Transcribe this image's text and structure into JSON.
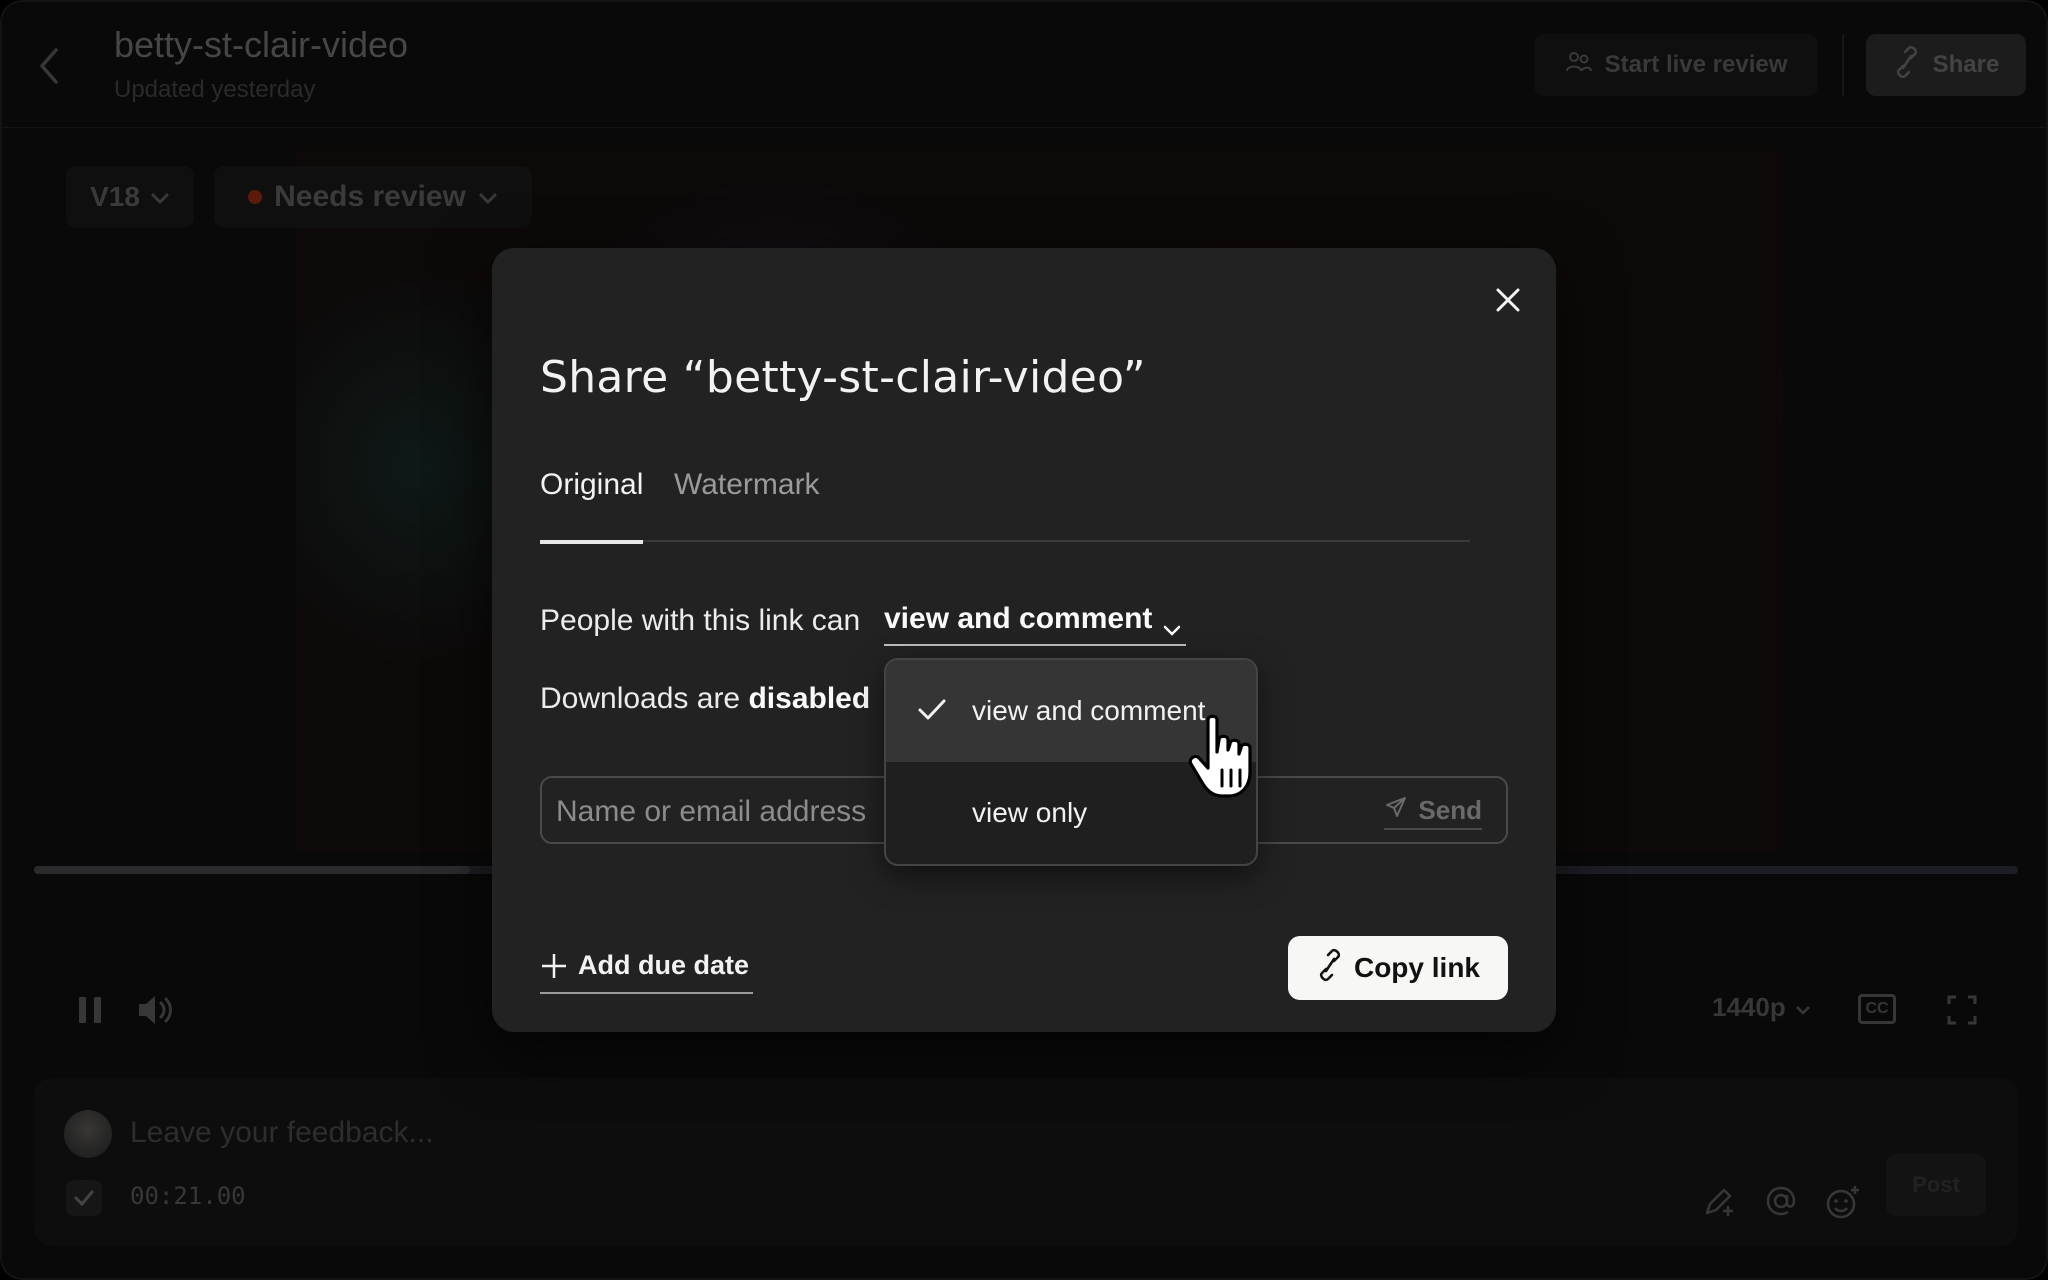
{
  "header": {
    "title": "betty-st-clair-video",
    "subtitle": "Updated yesterday",
    "live_review_label": "Start live review",
    "share_label": "Share"
  },
  "toolbar": {
    "version_label": "V18",
    "status_label": "Needs review",
    "status_color": "#7a2410"
  },
  "player": {
    "progress": 0.22,
    "quality_label": "1440p",
    "cc_label": "CC"
  },
  "comment": {
    "placeholder": "Leave your feedback...",
    "timestamp": "00:21.00",
    "post_label": "Post"
  },
  "modal": {
    "title": "Share “betty-st-clair-video”",
    "tabs": [
      {
        "label": "Original",
        "active": true
      },
      {
        "label": "Watermark",
        "active": false
      }
    ],
    "permission_prefix": "People with this link can",
    "permission_value": "view and comment",
    "downloads_prefix": "Downloads are",
    "downloads_value": "disabled",
    "invite_placeholder": "Name or email address",
    "send_label": "Send",
    "due_date_label": "Add due date",
    "copy_link_label": "Copy link"
  },
  "dropdown": {
    "options": [
      {
        "label": "view and comment",
        "selected": true
      },
      {
        "label": "view only",
        "selected": false
      }
    ]
  },
  "icons": {
    "back": "chevron-left-icon",
    "live": "people-icon",
    "share": "link-icon",
    "close": "close-icon",
    "send": "paper-plane-icon",
    "check": "check-icon",
    "cursor": "hand-pointer-icon"
  }
}
